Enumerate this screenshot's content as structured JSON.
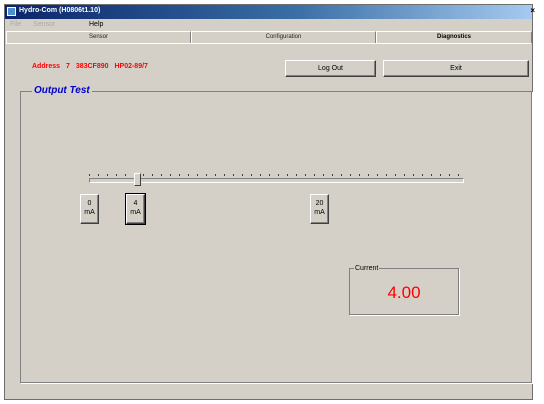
{
  "window": {
    "title": "Hydro-Com (H0806t1.10)"
  },
  "menu": {
    "items": [
      "File",
      "Sensor",
      "Help"
    ]
  },
  "tabs": [
    {
      "label": "Sensor",
      "active": false
    },
    {
      "label": "Configuration",
      "active": false
    },
    {
      "label": "Diagnostics",
      "active": true
    }
  ],
  "device": {
    "address": "Address 7",
    "serial": "383CF890",
    "model": "HP02-89/7"
  },
  "buttons": {
    "log_out": "Log Out",
    "exit": "Exit"
  },
  "output_test": {
    "title": "Output Test",
    "slider": {
      "min_ma": 0,
      "max_ma": 20,
      "value_ma": 4
    },
    "presets": [
      {
        "value": "0",
        "unit": "mA"
      },
      {
        "value": "4",
        "unit": "mA"
      },
      {
        "value": "20",
        "unit": "mA"
      }
    ],
    "current": {
      "label": "Current",
      "value": "4.00"
    }
  },
  "colors": {
    "window_bg": "#d4d0c8",
    "title_bar": "#0a246a",
    "alert_text": "#ff0000",
    "group_title": "#0000cc"
  }
}
